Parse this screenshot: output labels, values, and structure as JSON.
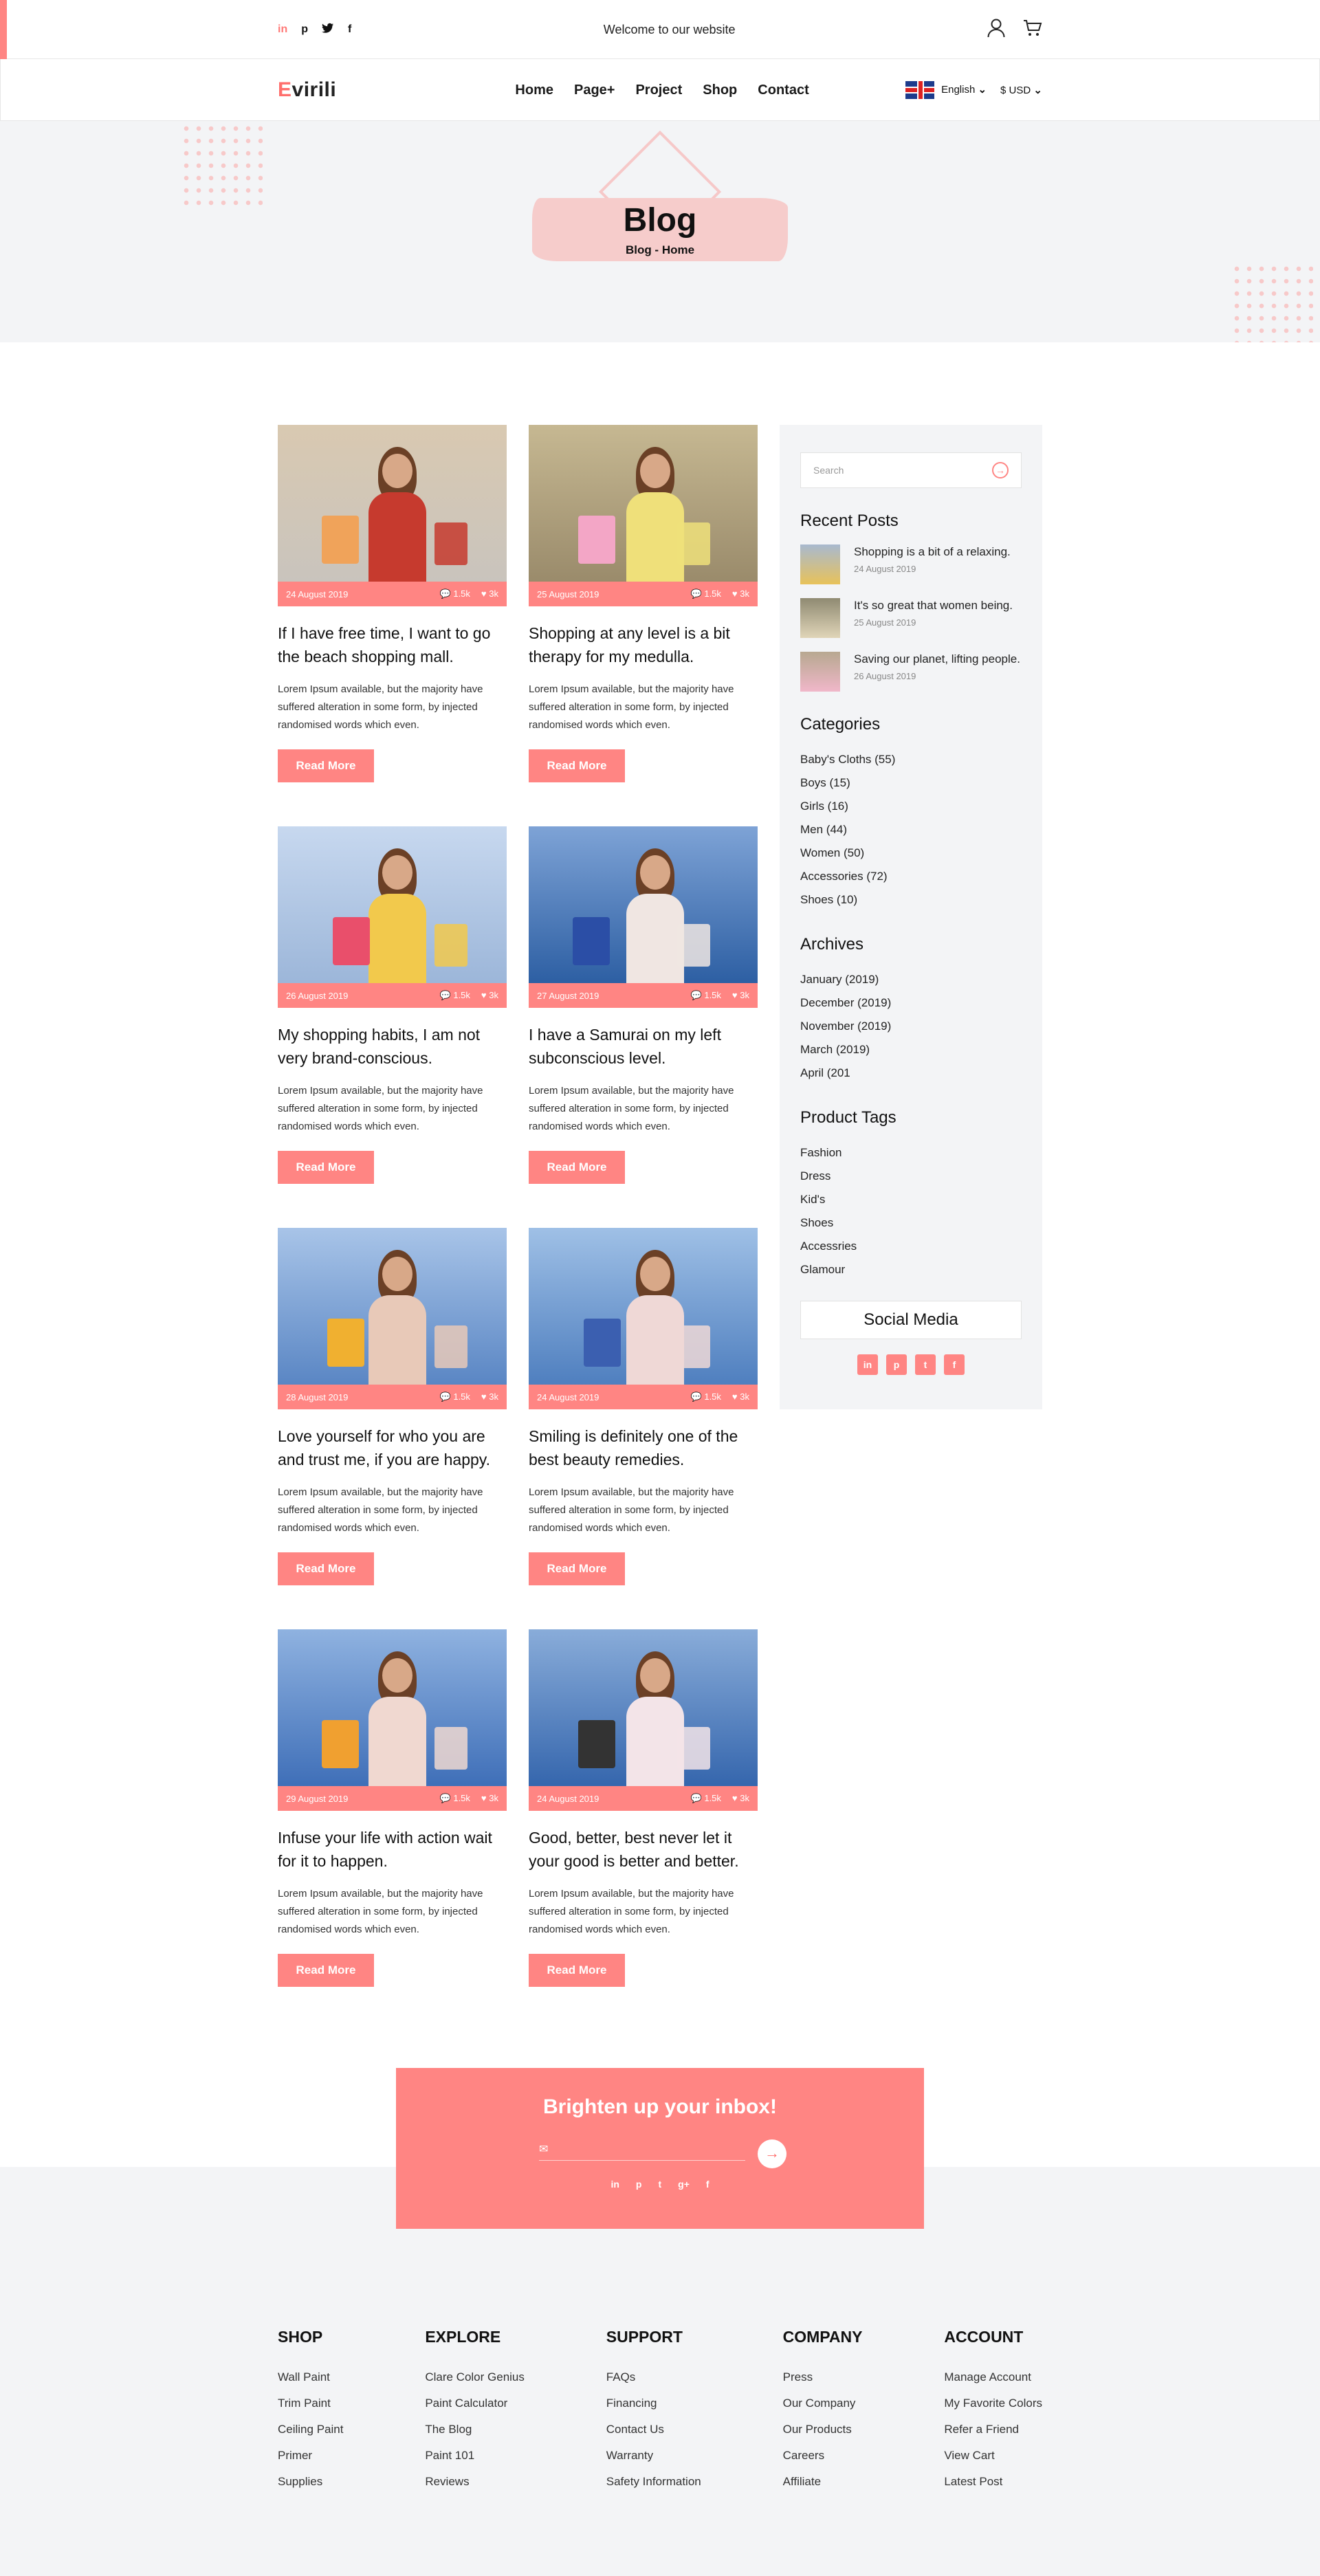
{
  "topbar": {
    "social": [
      "in",
      "p",
      "t",
      "f"
    ],
    "welcome": "Welcome to our website"
  },
  "nav": {
    "logo_first": "E",
    "logo_rest": "virili",
    "menu": [
      "Home",
      "Page+",
      "Project",
      "Shop",
      "Contact"
    ],
    "language": "English",
    "currency": "$ USD"
  },
  "hero": {
    "title": "Blog",
    "breadcrumb": "Blog - Home"
  },
  "posts": [
    {
      "date": "24 August 2019",
      "views": "1.5k",
      "likes": "3k",
      "title": "If I have free time, I want to go the beach shopping mall.",
      "excerpt": "Lorem Ipsum available, but the majority have suffered alteration in some form, by injected randomised words which even.",
      "button": "Read More"
    },
    {
      "date": "25 August 2019",
      "views": "1.5k",
      "likes": "3k",
      "title": "Shopping at any level is a bit therapy for my medulla.",
      "excerpt": "Lorem Ipsum available, but the majority have suffered alteration in some form, by injected randomised words which even.",
      "button": "Read More"
    },
    {
      "date": "26 August 2019",
      "views": "1.5k",
      "likes": "3k",
      "title": "My shopping habits, I am not very brand-conscious.",
      "excerpt": "Lorem Ipsum available, but the majority have suffered alteration in some form, by injected randomised words which even.",
      "button": "Read More"
    },
    {
      "date": "27 August 2019",
      "views": "1.5k",
      "likes": "3k",
      "title": "I have a Samurai on my left subconscious level.",
      "excerpt": "Lorem Ipsum available, but the majority have suffered alteration in some form, by injected randomised words which even.",
      "button": "Read More"
    },
    {
      "date": "28 August 2019",
      "views": "1.5k",
      "likes": "3k",
      "title": "Love yourself for who you are and trust me, if you are happy.",
      "excerpt": "Lorem Ipsum available, but the majority have suffered alteration in some form, by injected randomised words which even.",
      "button": "Read More"
    },
    {
      "date": "24 August 2019",
      "views": "1.5k",
      "likes": "3k",
      "title": "Smiling is definitely one of the best beauty remedies.",
      "excerpt": "Lorem Ipsum available, but the majority have suffered alteration in some form, by injected randomised words which even.",
      "button": "Read More"
    },
    {
      "date": "29 August 2019",
      "views": "1.5k",
      "likes": "3k",
      "title": "Infuse your life with action wait for it to happen.",
      "excerpt": "Lorem Ipsum available, but the majority have suffered alteration in some form, by injected randomised words which even.",
      "button": "Read More"
    },
    {
      "date": "24 August 2019",
      "views": "1.5k",
      "likes": "3k",
      "title": "Good, better, best never let it your good is better and better.",
      "excerpt": "Lorem Ipsum available, but the majority have suffered alteration in some form, by injected randomised words which even.",
      "button": "Read More"
    }
  ],
  "sidebar": {
    "search_placeholder": "Search",
    "recent_title": "Recent Posts",
    "recent": [
      {
        "title": "Shopping is a bit of a relaxing.",
        "date": "24 August 2019"
      },
      {
        "title": "It's so great that women being.",
        "date": "25 August 2019"
      },
      {
        "title": "Saving our planet, lifting people.",
        "date": "26 August 2019"
      }
    ],
    "categories_title": "Categories",
    "categories": [
      "Baby's Cloths (55)",
      "Boys (15)",
      "Girls (16)",
      "Men (44)",
      "Women (50)",
      "Accessories (72)",
      "Shoes (10)"
    ],
    "archives_title": "Archives",
    "archives": [
      "January (2019)",
      "December (2019)",
      "November (2019)",
      "March (2019)",
      "April (201"
    ],
    "tags_title": "Product Tags",
    "tags": [
      "Fashion",
      "Dress",
      "Kid's",
      "Shoes",
      "Accessries",
      "Glamour"
    ],
    "social_title": "Social Media",
    "social_icons": [
      "in",
      "p",
      "t",
      "f"
    ]
  },
  "newsletter": {
    "title": "Brighten up your inbox!",
    "social": [
      "in",
      "p",
      "t",
      "g+",
      "f"
    ]
  },
  "footer": {
    "columns": [
      {
        "title": "SHOP",
        "items": [
          "Wall Paint",
          "Trim Paint",
          "Ceiling Paint",
          "Primer",
          "Supplies"
        ]
      },
      {
        "title": "EXPLORE",
        "items": [
          "Clare Color Genius",
          "Paint Calculator",
          "The Blog",
          "Paint 101",
          "Reviews"
        ]
      },
      {
        "title": "SUPPORT",
        "items": [
          "FAQs",
          "Financing",
          "Contact Us",
          "Warranty",
          "Safety Information"
        ]
      },
      {
        "title": "COMPANY",
        "items": [
          "Press",
          "Our Company",
          "Our Products",
          "Careers",
          "Affiliate"
        ]
      },
      {
        "title": "ACCOUNT",
        "items": [
          "Manage Account",
          "My Favorite Colors",
          "Refer a Friend",
          "View Cart",
          "Latest Post"
        ]
      }
    ]
  },
  "colors": {
    "accent": "#ff8583",
    "light_bg": "#f3f4f6"
  }
}
